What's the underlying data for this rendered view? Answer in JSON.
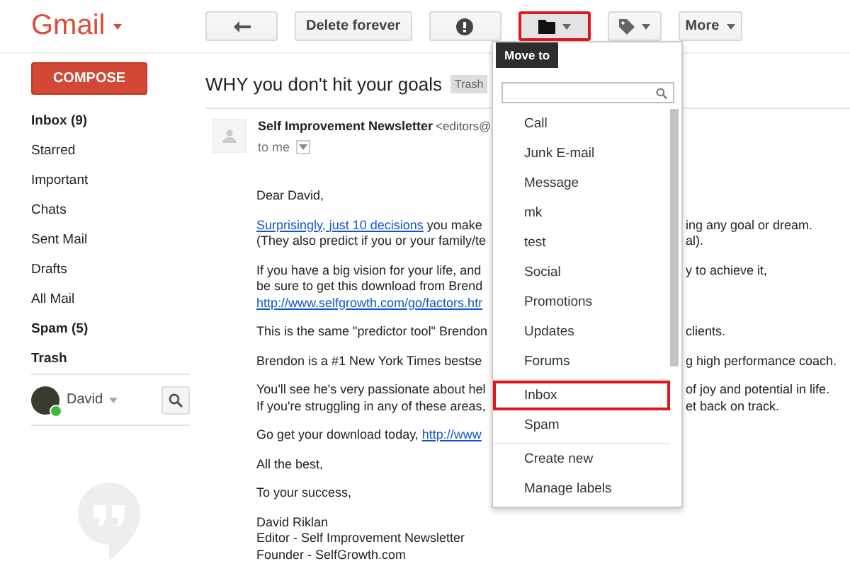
{
  "app": {
    "logo": "Gmail"
  },
  "toolbar": {
    "buttons": [
      {
        "kind": "back",
        "selected": false
      },
      {
        "kind": "text",
        "label": "Delete forever",
        "selected": false
      },
      {
        "kind": "spam",
        "selected": false
      },
      {
        "kind": "folder",
        "selected": true
      },
      {
        "kind": "tag",
        "selected": false
      },
      {
        "kind": "more",
        "label": "More",
        "selected": false
      }
    ]
  },
  "tooltip": "Move to",
  "sidebar": {
    "compose": "COMPOSE",
    "folders": [
      {
        "label": "Inbox (9)",
        "bold": true
      },
      {
        "label": "Starred",
        "bold": false
      },
      {
        "label": "Important",
        "bold": false
      },
      {
        "label": "Chats",
        "bold": false
      },
      {
        "label": "Sent Mail",
        "bold": false
      },
      {
        "label": "Drafts",
        "bold": false
      },
      {
        "label": "All Mail",
        "bold": false
      },
      {
        "label": "Spam (5)",
        "bold": true
      },
      {
        "label": "Trash",
        "bold": true
      }
    ],
    "user": {
      "name": "David",
      "online": true
    }
  },
  "email": {
    "subject": "WHY you don't hit your goals",
    "label": "Trash",
    "sender": "Self Improvement Newsletter",
    "sender_email": "<editors@",
    "recipient": "to me",
    "paragraphs": [
      [
        {
          "parts": [
            {
              "text": "Dear David,",
              "link": false
            }
          ]
        }
      ],
      [
        {
          "parts": [
            {
              "text": "Surprisingly, just 10 decisions",
              "link": true
            },
            {
              "text": " you make",
              "link": false
            }
          ],
          "rest": "ing any goal or dream."
        },
        {
          "parts": [
            {
              "text": "(They also predict if you or your family/te",
              "link": false
            }
          ],
          "rest": "al)."
        }
      ],
      [
        {
          "parts": [
            {
              "text": "If you have a big vision for your life, and",
              "link": false
            }
          ],
          "rest": "y to achieve it,"
        },
        {
          "parts": [
            {
              "text": "be sure to get this download from Brend",
              "link": false
            }
          ]
        },
        {
          "parts": [
            {
              "text": "http://www.selfgrowth.com/go/factors.htr",
              "link": true
            }
          ]
        }
      ],
      [
        {
          "parts": [
            {
              "text": "This is the same \"predictor tool\" Brendon",
              "link": false
            }
          ],
          "rest": "clients."
        }
      ],
      [
        {
          "parts": [
            {
              "text": "Brendon is a #1 New York Times bestse",
              "link": false
            }
          ],
          "rest": "g high performance coach."
        }
      ],
      [
        {
          "parts": [
            {
              "text": "You'll see he's very passionate about hel",
              "link": false
            }
          ],
          "rest": "of joy and potential in life."
        },
        {
          "parts": [
            {
              "text": "If you're struggling in any of these areas,",
              "link": false
            }
          ],
          "rest": "et back on track."
        }
      ],
      [
        {
          "parts": [
            {
              "text": "Go get your download today, ",
              "link": false
            },
            {
              "text": "http://www",
              "link": true
            }
          ]
        }
      ],
      [
        {
          "parts": [
            {
              "text": "All the best,",
              "link": false
            }
          ]
        }
      ],
      [
        {
          "parts": [
            {
              "text": "To your success,",
              "link": false
            }
          ]
        }
      ],
      [
        {
          "parts": [
            {
              "text": "David Riklan",
              "link": false
            }
          ]
        },
        {
          "parts": [
            {
              "text": "Editor - Self Improvement Newsletter",
              "link": false
            }
          ]
        },
        {
          "parts": [
            {
              "text": "Founder - SelfGrowth.com",
              "link": false
            }
          ]
        }
      ]
    ]
  },
  "move_menu": {
    "sections": [
      [
        {
          "label": "Call",
          "selected": false
        },
        {
          "label": "Junk E-mail",
          "selected": false
        },
        {
          "label": "Message",
          "selected": false
        },
        {
          "label": "mk",
          "selected": false
        },
        {
          "label": "test",
          "selected": false
        },
        {
          "label": "Social",
          "selected": false
        },
        {
          "label": "Promotions",
          "selected": false
        },
        {
          "label": "Updates",
          "selected": false
        },
        {
          "label": "Forums",
          "selected": false
        }
      ],
      [
        {
          "label": "Inbox",
          "selected": true
        },
        {
          "label": "Spam",
          "selected": false
        }
      ],
      [
        {
          "label": "Create new",
          "selected": false
        },
        {
          "label": "Manage labels",
          "selected": false
        }
      ]
    ]
  }
}
